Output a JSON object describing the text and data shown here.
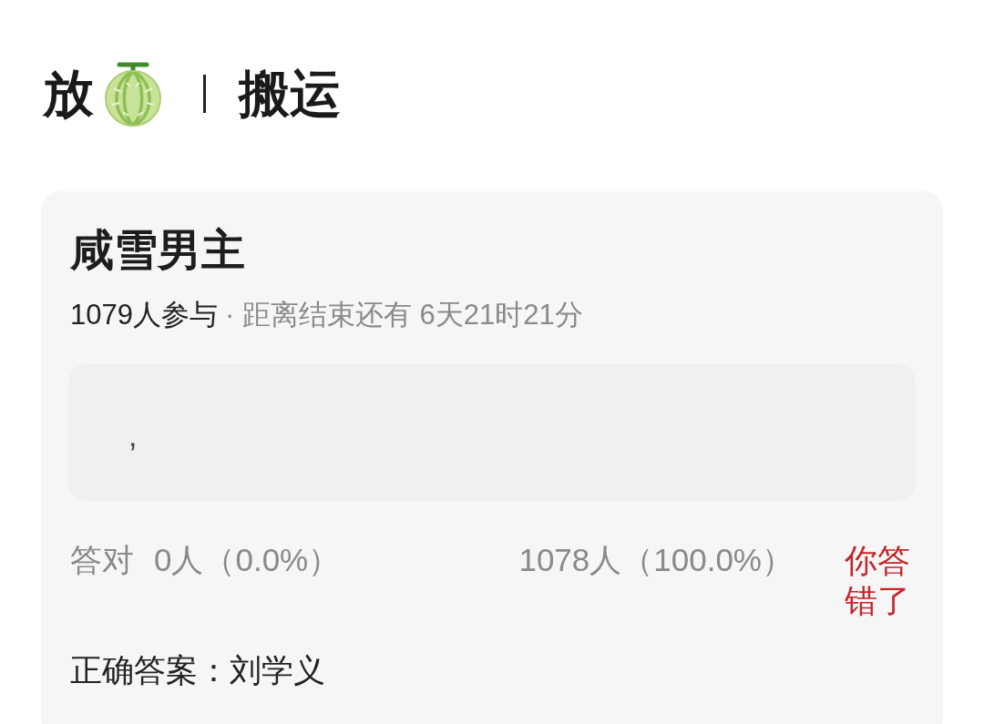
{
  "header": {
    "title_start": "放",
    "title_end": "搬运"
  },
  "card": {
    "title": "咸雪男主",
    "participants": "1079人参与",
    "deadline": "· 距离结束还有 6天21时21分",
    "answer": ",",
    "stats": {
      "correct_label": "答对",
      "correct_count": "0人（0.0%）",
      "wrong_count": "1078人（100.0%）",
      "result": {
        "text": "你答错了",
        "correct": false
      }
    },
    "correct_answer": "正确答案：刘学义"
  }
}
